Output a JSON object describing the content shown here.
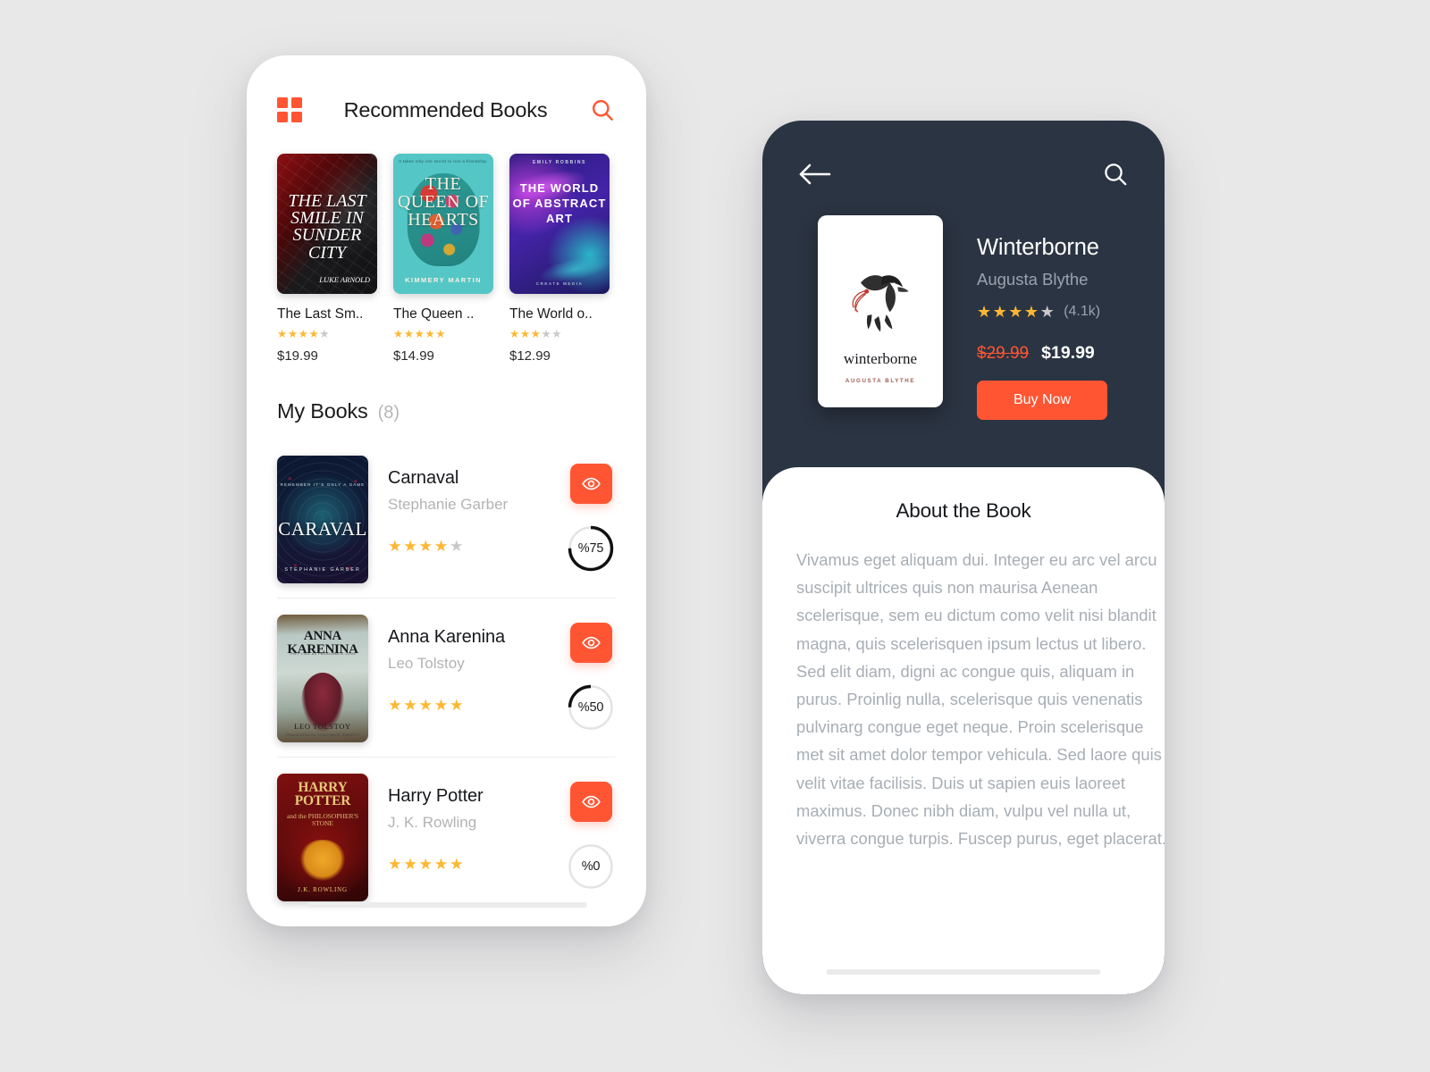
{
  "screen_left": {
    "header": {
      "grid_icon": "grid-menu-icon",
      "title": "Recommended Books",
      "search_icon": "search-icon"
    },
    "recommended": [
      {
        "title": "The Last Sm..",
        "cover_title": "THE LAST SMILE IN SUNDER CITY",
        "cover_author": "LUKE ARNOLD",
        "cover_top": "",
        "price": "$19.99",
        "rating": 4,
        "max_rating": 5
      },
      {
        "title": "The Queen ..",
        "cover_title": "THE QUEEN OF HEARTS",
        "cover_author": "KIMMERY MARTIN",
        "cover_top": "It takes only one secret to ruin a friendship.",
        "price": "$14.99",
        "rating": 5,
        "max_rating": 5
      },
      {
        "title": "The World o..",
        "cover_title": "THE WORLD OF ABSTRACT ART",
        "cover_author": "CREATE MEDIA",
        "cover_top": "EMILY ROBBINS",
        "price": "$12.99",
        "rating": 3,
        "max_rating": 5
      }
    ],
    "my_books": {
      "label": "My Books",
      "count": "(8)",
      "items": [
        {
          "title": "Carnaval",
          "author": "Stephanie Garber",
          "rating": 4,
          "max_rating": 5,
          "progress_label": "%75",
          "progress_value": 75,
          "action_icon": "eye-icon",
          "cover_title": "CARAVAL",
          "cover_top": "REMEMBER IT'S ONLY A GAME",
          "cover_author": "STEPHANIE GARBER"
        },
        {
          "title": "Anna Karenina",
          "author": "Leo Tolstoy",
          "rating": 5,
          "max_rating": 5,
          "progress_label": "%50",
          "progress_value": 50,
          "action_icon": "eye-icon",
          "cover_title": "ANNA KARENINA",
          "cover_top": "THEY LIVE AS PASSIONATE LOVE",
          "cover_author": "LEO TOLSTOY",
          "cover_author2": "TRANSLATED BY CONSTANCE GARNETT"
        },
        {
          "title": "Harry Potter",
          "author": "J. K. Rowling",
          "rating": 5,
          "max_rating": 5,
          "progress_label": "%0",
          "progress_value": 0,
          "action_icon": "eye-icon",
          "cover_title": "HARRY POTTER",
          "cover_top": "and the PHILOSOPHER'S STONE",
          "cover_author": "J.K. ROWLING"
        }
      ]
    }
  },
  "screen_right": {
    "header": {
      "back_icon": "back-arrow-icon",
      "search_icon": "search-icon"
    },
    "book": {
      "title": "Winterborne",
      "author": "Augusta Blythe",
      "rating": 4,
      "max_rating": 5,
      "rating_count": "(4.1k)",
      "price_old": "$29.99",
      "price_new": "$19.99",
      "buy_label": "Buy Now",
      "cover_title": "winterborne",
      "cover_author": "AUGUSTA BLYTHE",
      "cover_art": "raven-illustration"
    },
    "about": {
      "heading": "About the Book",
      "body": "Vivamus eget aliquam dui. Integer eu arc vel arcu suscipit ultrices quis non maurisa Aenean scelerisque, sem eu dictum como velit nisi blandit magna, quis scelerisquen ipsum lectus ut libero. Sed elit diam, digni ac congue quis, aliquam in purus. Proinlig nulla, scelerisque quis venenatis pulvinarg congue eget neque. Proin scelerisque met sit amet dolor tempor vehicula. Sed laore quis velit vitae facilisis. Duis ut sapien euis laoreet maximus. Donec nibh diam, vulpu vel nulla ut, viverra congue turpis. Fuscep purus, eget placerat."
    }
  },
  "colors": {
    "accent": "#ff5533",
    "dark": "#2b3442",
    "star_on": "#fdb833",
    "star_off": "#c9c9c9",
    "page_bg": "#e8e8e8"
  }
}
